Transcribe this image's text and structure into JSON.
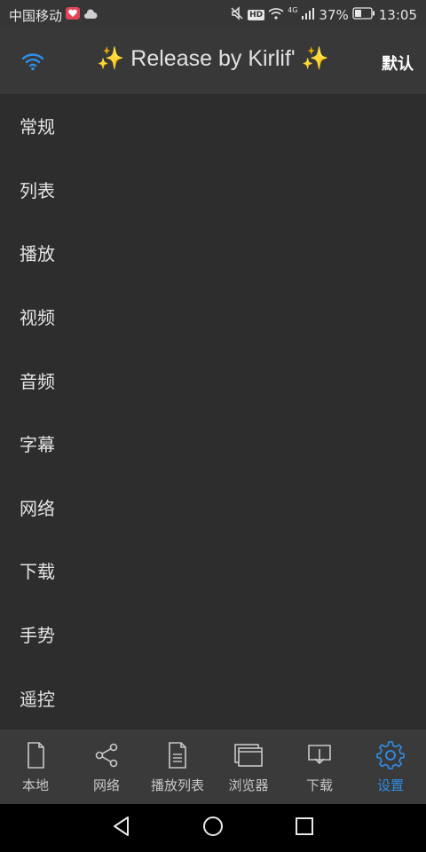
{
  "statusbar": {
    "carrier": "中国移动",
    "hd_badge": "HD",
    "network": "4G",
    "battery": "37%",
    "time": "13:05"
  },
  "appbar": {
    "title": "Release by Kirlif'",
    "default_label": "默认"
  },
  "menu": {
    "items": [
      {
        "label": "常规"
      },
      {
        "label": "列表"
      },
      {
        "label": "播放"
      },
      {
        "label": "视频"
      },
      {
        "label": "音频"
      },
      {
        "label": "字幕"
      },
      {
        "label": "网络"
      },
      {
        "label": "下载"
      },
      {
        "label": "手势"
      },
      {
        "label": "遥控"
      }
    ]
  },
  "bottomnav": {
    "items": [
      {
        "label": "本地",
        "icon": "file-icon"
      },
      {
        "label": "网络",
        "icon": "share-icon"
      },
      {
        "label": "播放列表",
        "icon": "playlist-icon"
      },
      {
        "label": "浏览器",
        "icon": "browser-icon"
      },
      {
        "label": "下载",
        "icon": "download-icon"
      },
      {
        "label": "设置",
        "icon": "gear-icon"
      }
    ],
    "active_index": 5
  },
  "colors": {
    "accent": "#2f8ee6",
    "background": "#2d2d2d",
    "appbar": "#383838",
    "bottomnav": "#3a3a3a",
    "sparkle": "#f2d430"
  }
}
